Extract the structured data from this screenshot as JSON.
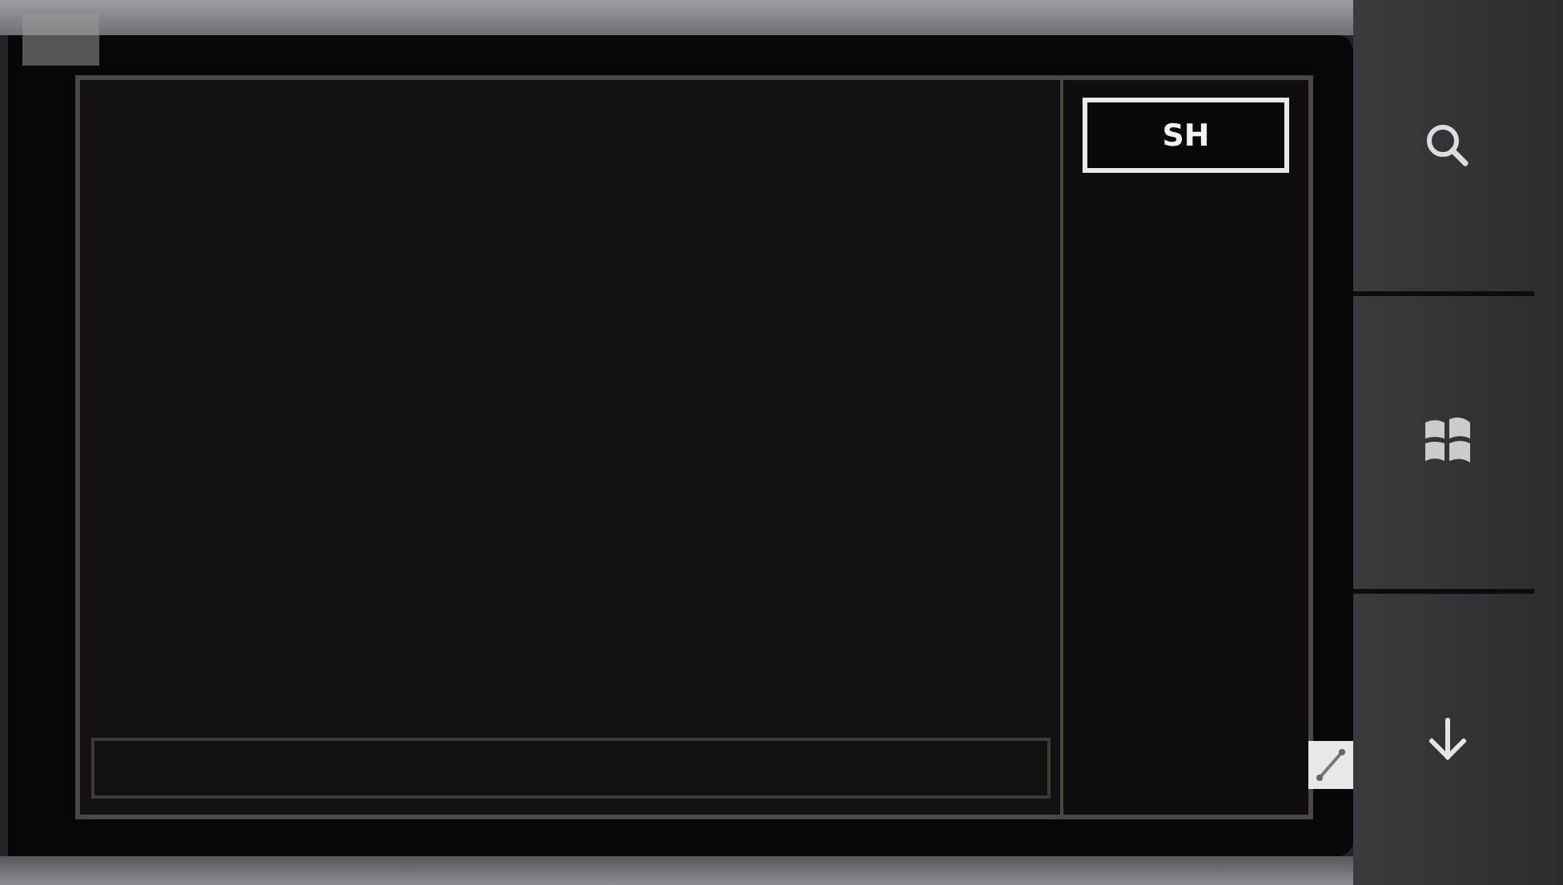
{
  "app": {
    "button": {
      "label": "SH"
    }
  }
}
